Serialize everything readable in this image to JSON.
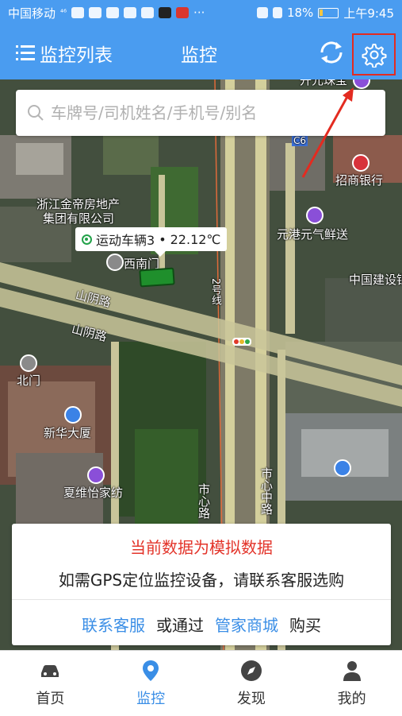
{
  "statusbar": {
    "carrier": "中国移动",
    "signal": "⁴⁶",
    "battery_pct": "18%",
    "time": "上午9:45"
  },
  "header": {
    "list_label": "监控列表",
    "title": "监控"
  },
  "search": {
    "placeholder": "车牌号/司机姓名/手机号/别名"
  },
  "map": {
    "labels": {
      "l1": "开元珠宝",
      "l2": "招商银行",
      "l3": "浙江金帝房地产",
      "l4": "集团有限公司",
      "l5": "元港元气鲜送",
      "l6": "西南门",
      "l7": "中国建设银",
      "l8": "山阴路",
      "l9": "山阴路",
      "l10": "北门",
      "l11": "新华大厦",
      "l12": "夏维怡家纺",
      "l13": "市心中路",
      "l14": "市心路",
      "l15": "2号线",
      "l16": "C6"
    },
    "vehicle": {
      "name": "运动车辆3",
      "separator": "•",
      "temperature": "22.12℃"
    }
  },
  "notice": {
    "warning": "当前数据为模拟数据",
    "message": "如需GPS定位监控设备，请联系客服选购",
    "contact_link": "联系客服",
    "or_text": "或通过",
    "mall_link": "管家商城",
    "buy_text": "购买"
  },
  "nav": {
    "items": [
      {
        "label": "首页"
      },
      {
        "label": "监控"
      },
      {
        "label": "发现"
      },
      {
        "label": "我的"
      }
    ]
  },
  "colors": {
    "primary": "#4a9cf0",
    "accent_link": "#3a8ee6",
    "warning": "#e3342a",
    "status_green": "#23a24a",
    "highlight_box": "#e32b20"
  }
}
